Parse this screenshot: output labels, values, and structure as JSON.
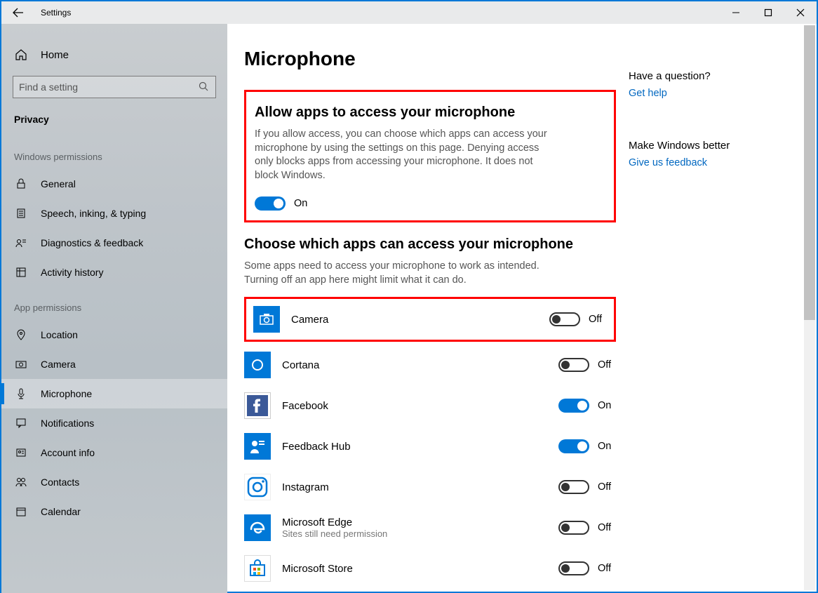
{
  "window": {
    "title": "Settings"
  },
  "sidebar": {
    "home": "Home",
    "search_placeholder": "Find a setting",
    "category": "Privacy",
    "group1_header": "Windows permissions",
    "group1": [
      {
        "label": "General"
      },
      {
        "label": "Speech, inking, & typing"
      },
      {
        "label": "Diagnostics & feedback"
      },
      {
        "label": "Activity history"
      }
    ],
    "group2_header": "App permissions",
    "group2": [
      {
        "label": "Location"
      },
      {
        "label": "Camera"
      },
      {
        "label": "Microphone"
      },
      {
        "label": "Notifications"
      },
      {
        "label": "Account info"
      },
      {
        "label": "Contacts"
      },
      {
        "label": "Calendar"
      }
    ]
  },
  "page": {
    "title": "Microphone",
    "section1_title": "Allow apps to access your microphone",
    "section1_desc": "If you allow access, you can choose which apps can access your microphone by using the settings on this page. Denying access only blocks apps from accessing your microphone. It does not block Windows.",
    "master_toggle": {
      "on": true,
      "label": "On"
    },
    "section2_title": "Choose which apps can access your microphone",
    "section2_desc": "Some apps need to access your microphone to work as intended. Turning off an app here might limit what it can do.",
    "apps": [
      {
        "name": "Camera",
        "on": false,
        "state": "Off",
        "highlight": true
      },
      {
        "name": "Cortana",
        "on": false,
        "state": "Off"
      },
      {
        "name": "Facebook",
        "on": true,
        "state": "On"
      },
      {
        "name": "Feedback Hub",
        "on": true,
        "state": "On"
      },
      {
        "name": "Instagram",
        "on": false,
        "state": "Off"
      },
      {
        "name": "Microsoft Edge",
        "sub": "Sites still need permission",
        "on": false,
        "state": "Off"
      },
      {
        "name": "Microsoft Store",
        "on": false,
        "state": "Off"
      }
    ]
  },
  "right": {
    "q_title": "Have a question?",
    "q_link": "Get help",
    "fb_title": "Make Windows better",
    "fb_link": "Give us feedback"
  }
}
